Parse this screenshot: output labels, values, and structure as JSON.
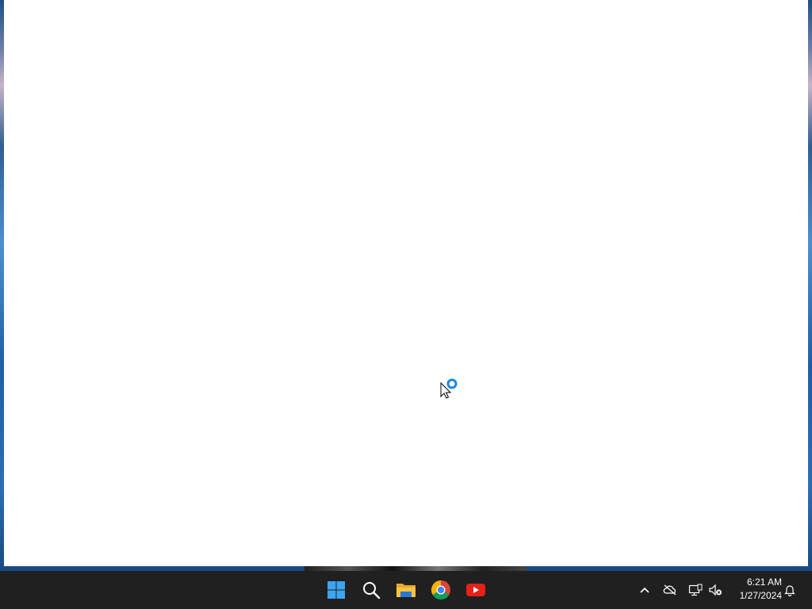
{
  "window": {
    "name": "blank-app-window"
  },
  "cursor": {
    "state": "working-in-background"
  },
  "taskbar": {
    "apps": [
      {
        "name": "Start",
        "icon": "windows-start-icon"
      },
      {
        "name": "Search",
        "icon": "search-icon"
      },
      {
        "name": "File Explorer",
        "icon": "folder-icon"
      },
      {
        "name": "Google Chrome",
        "icon": "chrome-icon"
      },
      {
        "name": "YouTube",
        "icon": "youtube-icon"
      }
    ],
    "tray": {
      "icons": [
        "chevron-up-icon",
        "onedrive-offline-icon",
        "network-icon",
        "volume-muted-icon",
        "notifications-bell-icon"
      ]
    },
    "clock": {
      "time": "6:21 AM",
      "date": "1/27/2024"
    }
  },
  "colors": {
    "taskbar_bg": "#202020",
    "window_bg": "#ffffff",
    "windows_blue": "#3ca4f0",
    "youtube_red": "#e62117",
    "folder_yellow": "#f6c343",
    "cursor_busy_blue": "#1e88d6"
  }
}
